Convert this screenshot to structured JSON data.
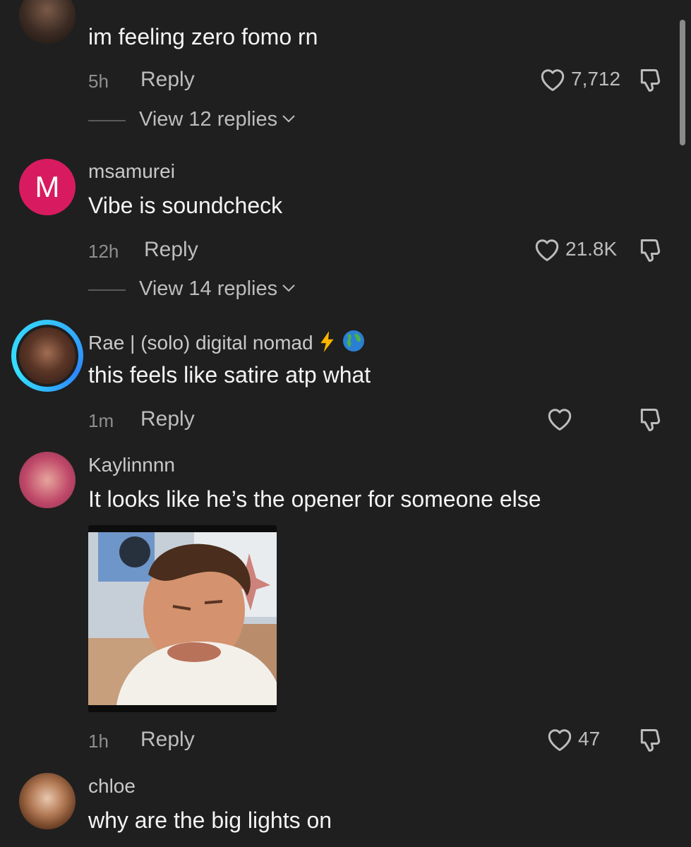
{
  "colors": {
    "background": "#1f1f1f",
    "letter_avatar": "#d81b60",
    "story_ring": "#35c7ff"
  },
  "icons": {
    "like": "heart-outline-icon",
    "dislike": "thumbs-down-icon",
    "expand": "chevron-down-icon"
  },
  "comments": [
    {
      "username": "",
      "text": "im feeling zero fomo rn",
      "time": "5h",
      "reply_label": "Reply",
      "likes": "7,712",
      "view_replies": "View 12 replies"
    },
    {
      "avatar_letter": "M",
      "username": "msamurei",
      "text": "Vibe is soundcheck",
      "time": "12h",
      "reply_label": "Reply",
      "likes": "21.8K",
      "view_replies": "View 14 replies"
    },
    {
      "username": "Rae | (solo) digital nomad",
      "username_emojis": [
        "lightning-emoji",
        "globe-emoji"
      ],
      "text": "this feels like satire atp what",
      "time": "1m",
      "reply_label": "Reply",
      "likes": ""
    },
    {
      "username": "Kaylinnnn",
      "text": "It looks like he’s the opener for someone else",
      "has_image_attachment": true,
      "time": "1h",
      "reply_label": "Reply",
      "likes": "47"
    },
    {
      "username": "chloe",
      "text": "why are the big lights on"
    }
  ]
}
